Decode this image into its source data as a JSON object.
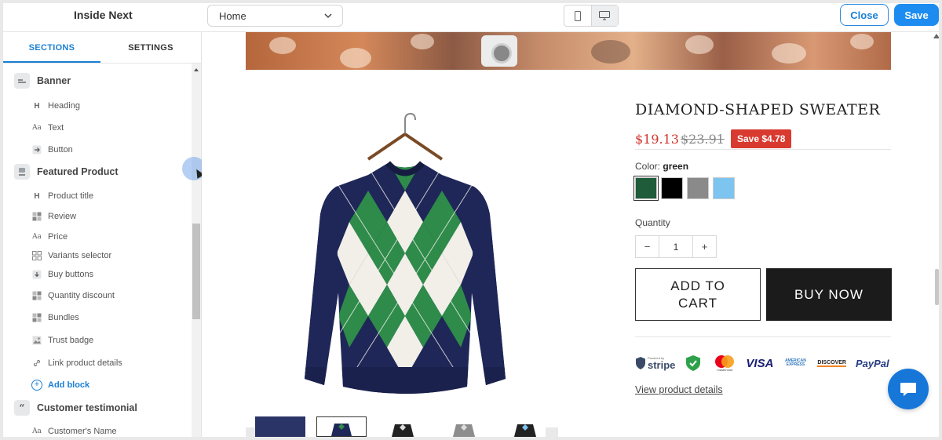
{
  "topbar": {
    "app_title": "Inside Next",
    "page_select": {
      "value": "Home"
    },
    "close_label": "Close",
    "save_label": "Save",
    "device_mode": "desktop"
  },
  "sidebar": {
    "tabs": [
      {
        "label": "SECTIONS",
        "active": true
      },
      {
        "label": "SETTINGS",
        "active": false
      }
    ],
    "banner": {
      "label": "Banner",
      "blocks": [
        {
          "label": "Heading",
          "icon": "heading-icon"
        },
        {
          "label": "Text",
          "icon": "text-icon"
        },
        {
          "label": "Button",
          "icon": "button-icon"
        }
      ]
    },
    "featured": {
      "label": "Featured Product",
      "blocks": [
        {
          "label": "Product title",
          "icon": "heading-icon"
        },
        {
          "label": "Review",
          "icon": "review-icon"
        },
        {
          "label": "Price",
          "icon": "text-icon"
        },
        {
          "label": "Variants selector",
          "icon": "variants-icon"
        },
        {
          "label": "Buy buttons",
          "icon": "buy-buttons-icon"
        },
        {
          "label": "Quantity discount",
          "icon": "quantity-discount-icon"
        },
        {
          "label": "Bundles",
          "icon": "bundles-icon"
        },
        {
          "label": "Trust badge",
          "icon": "image-icon"
        },
        {
          "label": "Link product details",
          "icon": "link-icon"
        }
      ],
      "add_block": "Add block"
    },
    "testimonial": {
      "label": "Customer testimonial",
      "blocks": [
        {
          "label": "Customer's Name",
          "icon": "text-icon"
        }
      ]
    }
  },
  "product": {
    "title": "DIAMOND-SHAPED SWEATER",
    "price": "$19.13",
    "compare_price": "$23.91",
    "save_badge": "Save $4.78",
    "color_label": "Color:",
    "color_value": "green",
    "swatches": [
      {
        "name": "green",
        "color": "#1f5c3a",
        "selected": true
      },
      {
        "name": "black",
        "color": "#000000",
        "selected": false
      },
      {
        "name": "gray",
        "color": "#8a8a8a",
        "selected": false
      },
      {
        "name": "light-blue",
        "color": "#7ec4f0",
        "selected": false
      }
    ],
    "quantity_label": "Quantity",
    "quantity": "1",
    "add_to_cart": "ADD TO CART",
    "buy_now": "BUY NOW",
    "view_details": "View product details",
    "trust_badges": [
      "stripe",
      "ssl",
      "mastercard",
      "VISA",
      "American Express",
      "DISCOVER",
      "PayPal"
    ],
    "trust_text": {
      "stripe": "stripe",
      "stripe_small": "Powered by",
      "mastercard": "mastercard",
      "visa": "VISA",
      "amex": "AMERICAN EXPRESS",
      "discover": "DISCOVER",
      "paypal": "PayPal"
    }
  },
  "colors": {
    "accent": "#1d8cf0",
    "sale": "#d83a2f",
    "sweater_navy": "#1e2757",
    "sweater_green": "#2e8b4a",
    "sweater_cream": "#f1efe8"
  }
}
